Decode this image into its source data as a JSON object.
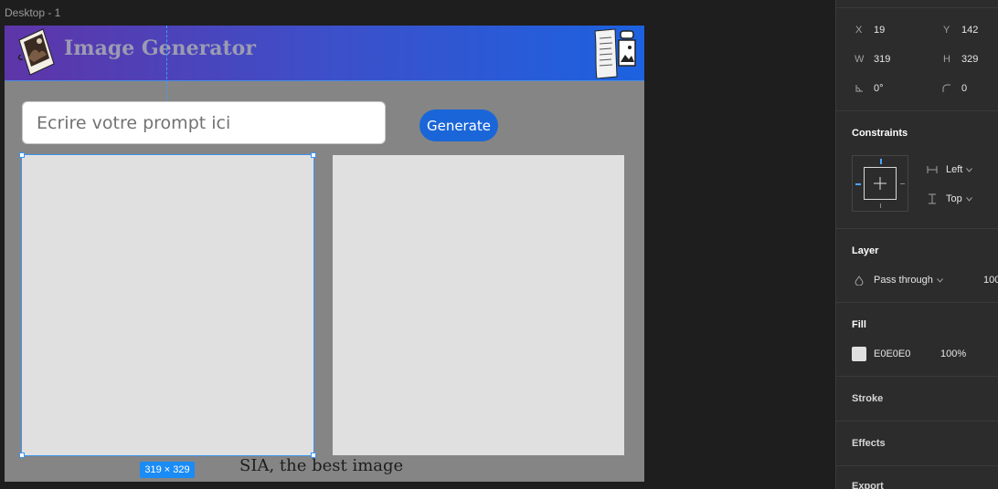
{
  "canvas": {
    "frame_label": "Desktop - 1",
    "app_title": "Image Generator",
    "prompt_placeholder": "Ecrire votre prompt ici",
    "generate_label": "Generate",
    "selection_size": "319 × 329",
    "tagline": "SIA, the best image"
  },
  "panel": {
    "position": {
      "x_label": "X",
      "x_value": "19",
      "y_label": "Y",
      "y_value": "142",
      "w_label": "W",
      "w_value": "319",
      "h_label": "H",
      "h_value": "329",
      "rotation_value": "0°",
      "radius_value": "0"
    },
    "constraints": {
      "title": "Constraints",
      "horizontal": "Left",
      "vertical": "Top"
    },
    "layer": {
      "title": "Layer",
      "blend_mode": "Pass through",
      "opacity": "100"
    },
    "fill": {
      "title": "Fill",
      "hex": "E0E0E0",
      "opacity": "100%"
    },
    "stroke": {
      "title": "Stroke"
    },
    "effects": {
      "title": "Effects"
    },
    "export": {
      "title": "Export"
    }
  },
  "colors": {
    "canvas_bg": "#1e1e1e",
    "frame_bg": "#858585",
    "image_fill": "#e0e0e0",
    "selection_blue": "#3d93ee",
    "button_blue": "#1a66d8",
    "panel_bg": "#2c2c2c"
  }
}
